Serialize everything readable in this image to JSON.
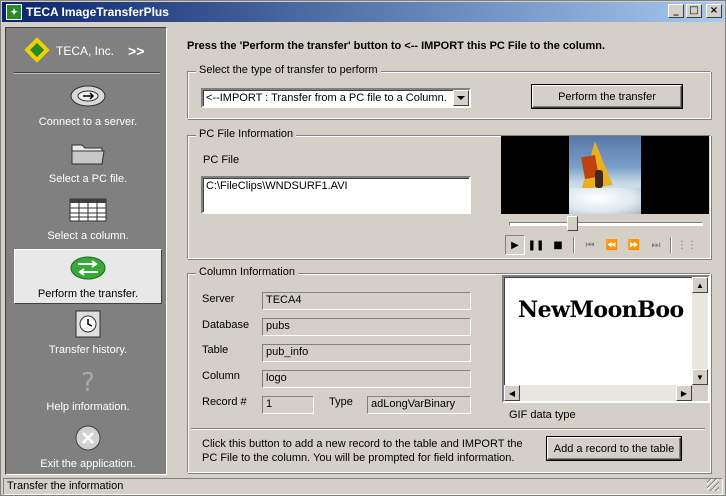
{
  "window": {
    "title": "TECA ImageTransferPlus"
  },
  "sidebar": {
    "brand": "TECA, Inc.",
    "brand_arrows": ">>",
    "items": [
      {
        "label": "Connect to a server.",
        "icon": "connect-icon"
      },
      {
        "label": "Select a PC file.",
        "icon": "folder-icon"
      },
      {
        "label": "Select a column.",
        "icon": "column-icon"
      },
      {
        "label": "Perform the transfer.",
        "icon": "transfer-icon",
        "active": true
      },
      {
        "label": "Transfer history.",
        "icon": "history-icon"
      },
      {
        "label": "Help information.",
        "icon": "help-icon"
      },
      {
        "label": "Exit the application.",
        "icon": "exit-icon"
      }
    ]
  },
  "main": {
    "instruction": "Press the 'Perform the transfer' button to  <-- IMPORT  this PC File to the column.",
    "transfer_type": {
      "legend": "Select the type of transfer to perform",
      "selected": "<--IMPORT : Transfer from a PC file to a Column.",
      "button": "Perform the transfer"
    },
    "pc_file": {
      "legend": "PC File Information",
      "label": "PC File",
      "value": "C:\\FileClips\\WNDSURF1.AVI"
    },
    "media_controls": [
      "▶",
      "❚❚",
      "■",
      "⏮",
      "⏪",
      "⏩",
      "⏭",
      "⋮⋮"
    ],
    "column": {
      "legend": "Column Information",
      "server_label": "Server",
      "server": "TECA4",
      "database_label": "Database",
      "database": "pubs",
      "table_label": "Table",
      "table": "pub_info",
      "column_label": "Column",
      "column": "logo",
      "record_label": "Record #",
      "record": "1",
      "type_label": "Type",
      "type": "adLongVarBinary",
      "image_text": "NewMoonBoo",
      "image_caption": "GIF data type"
    },
    "add_record": {
      "text": "Click this button to add a new record to the table and IMPORT the PC File to the column.  You will be prompted for field information.",
      "button": "Add a record to the table"
    }
  },
  "status": {
    "text": "Transfer the information"
  },
  "colors": {
    "titlebar_start": "#0a246a",
    "titlebar_end": "#a6caf0",
    "face": "#d4d0c8",
    "sidebar": "#808080"
  }
}
